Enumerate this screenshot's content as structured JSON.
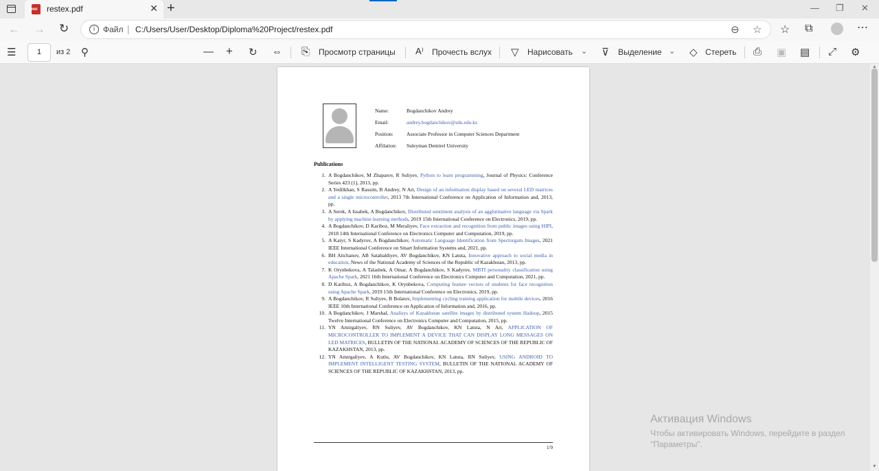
{
  "tabbar": {
    "tab_title": "restex.pdf",
    "close_glyph": "✕",
    "new_tab_glyph": "+",
    "window_controls": [
      "—",
      "❐",
      "✕"
    ]
  },
  "addressbar": {
    "url_label": "Файл",
    "url_separator": "|",
    "url": "C:/Users/User/Desktop/Diploma%20Project/restex.pdf"
  },
  "pdf_toolbar": {
    "page_current": "1",
    "page_count": "из 2",
    "page_view_label": "Просмотр страницы",
    "read_aloud_label": "Прочесть вслух",
    "draw_label": "Нарисовать",
    "highlight_label": "Выделение",
    "erase_label": "Стереть"
  },
  "document": {
    "fields": [
      {
        "key": "Name:",
        "value": "Bogdanchikov Andrey"
      },
      {
        "key": "Email:",
        "value": "andrey.bogdanchikov@sdu.edu.kz"
      },
      {
        "key": "Position:",
        "value": "Associate Professor in Computer Sciences Department"
      },
      {
        "key": "Affilation:",
        "value": "Suleyman Demirel University"
      }
    ],
    "section_title": "Publications",
    "publications": [
      {
        "num": "1.",
        "authors": "A Bogdanchikov, M Zhaparov, R Suliyev, ",
        "title": "Python to learn programming",
        "rest": ", Journal of Physics: Conference Series 423 (1), 2013, pp."
      },
      {
        "num": "2.",
        "authors": "A Yedilkhan, S Rassim, B Andrey, N Ari, ",
        "title": "Design of an information display based on several LED matrices and a single microcontroller",
        "rest": ", 2013 7th International Conference on Application of Information and, 2013, pp."
      },
      {
        "num": "3.",
        "authors": "A Serek, A Issabek, A Bogdanchikov, ",
        "title": "Distributed sentiment analysis of an agglutinative language via Spark by applying machine learning methods",
        "rest": ", 2019 15th International Conference on Electronics, 2019, pp."
      },
      {
        "num": "4.",
        "authors": "A Bogdanchikov, D Kariboz, M Meraliyev, ",
        "title": "Face extraction and recognition from public images using HIPI",
        "rest": ", 2018 14th International Conference on Electronics Computer and Computation, 2019, pp."
      },
      {
        "num": "5.",
        "authors": "A Kaiyr, S Kadyrov, A Bogdanchikov, ",
        "title": "Automatic Language Identification from Spectorgam Images",
        "rest": ", 2021 IEEE International Conference on Smart Information Systems and, 2021, pp."
      },
      {
        "num": "6.",
        "authors": "BH Aitchanov, AB Satabaldiyev, AV Bogdanchikov, KN Latuta, ",
        "title": "Innovative approach to social media in education",
        "rest": ", News of the National Academy of Sciences of the Republic of Kazakhstan, 2013, pp."
      },
      {
        "num": "7.",
        "authors": "K Orynbekova, A Talasbek, A Omar, A Bogdanchikov, S Kadyrov, ",
        "title": "MBTI personality classification using Apache Spark",
        "rest": ", 2021 16th International Conference on Electronics Computer and Computation, 2021, pp."
      },
      {
        "num": "8.",
        "authors": "D Kariboz, A Bogdanchikov, K Orynbekova, ",
        "title": "Computing feature vectors of students for face recognition using Apache Spark",
        "rest": ", 2019 15th International Conference on Electronics, 2019, pp."
      },
      {
        "num": "9.",
        "authors": "A Bogdanchikov, R Suliyev, B Bolatov, ",
        "title": "Implementing cycling training application for mobile devices",
        "rest": ", 2016 IEEE 10th International Conference on Application of Information and, 2016, pp."
      },
      {
        "num": "10.",
        "authors": "A Bogdanchikov, J Marshal, ",
        "title": "Analisys of Kazakhstan satellite images by distributed system Hadoop",
        "rest": ", 2015 Twelve International Conference on Electronics Computer and Computation, 2015, pp."
      },
      {
        "num": "11.",
        "authors": "YN Amirgaliyev, RN Suliyev, AV Bogdanchikov, KN Latuta, N Ari, ",
        "title": "APPLICATION OF MICROCONTROLLER TO IMPLEMENT A DEVICE THAT CAN DISPLAY LONG MESSAGES ON LED MATRICES",
        "rest": ", BULLETIN OF THE NATIONAL ACADEMY OF SCIENCES OF THE REPUBLIC OF KAZAKHSTAN, 2013, pp."
      },
      {
        "num": "12.",
        "authors": "YN Amirgaliyev, A Kutlu, AV Bogdanchikov, KN Latuta, RN Suliyev, ",
        "title": "USING ANDROID TO IMPLEMENT INTELLIGENT TESTING SYSTEM",
        "rest": ", BULLETIN OF THE NATIONAL ACADEMY OF SCIENCES OF THE REPUBLIC OF KAZAKHSTAN, 2013, pp."
      }
    ],
    "page_number": "1/9"
  },
  "watermark": {
    "title": "Активация Windows",
    "line1": "Чтобы активировать Windows, перейдите в раздел",
    "line2": "\"Параметры\"."
  },
  "colors": {
    "link": "#3d5fa9",
    "tab_pdf_icon": "#c4302b"
  }
}
